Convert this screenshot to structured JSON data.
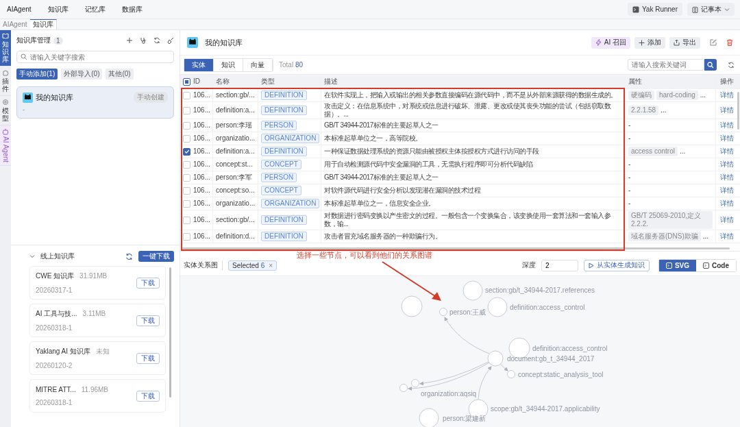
{
  "topnav": [
    "AIAgent",
    "知识库",
    "记忆库",
    "数据库"
  ],
  "top_actions": [
    {
      "label": "Yak Runner",
      "kind": "runner"
    },
    {
      "label": "记事本",
      "kind": "notes"
    }
  ],
  "page_tabs": [
    {
      "label": "AIAgent",
      "selected": false
    },
    {
      "label": "知识库",
      "selected": true
    }
  ],
  "rail": [
    {
      "label": "知识库",
      "kind": "book",
      "selected": true
    },
    {
      "label": "插件",
      "kind": "plugin",
      "selected": false
    },
    {
      "label": "模型",
      "kind": "model",
      "selected": false
    },
    {
      "label": "AI Agent",
      "kind": "agent",
      "selected": false
    }
  ],
  "kb_panel": {
    "title": "知识库管理",
    "count": "1",
    "search": {
      "placeholder": "请输入关键字搜索"
    },
    "filters": [
      {
        "label": "手动添加(1)",
        "selected": true
      },
      {
        "label": "外部导入(0)",
        "selected": false
      },
      {
        "label": "其他(0)",
        "selected": false
      }
    ],
    "cards": [
      {
        "name": "我的知识库",
        "tag": "手动创建",
        "description": "-",
        "selected": true
      }
    ]
  },
  "online": {
    "title": "线上知识库",
    "expanded": true,
    "download_all": "一键下载",
    "items": [
      {
        "name": "CWE 知识库",
        "size": "31.91MB",
        "version": "20260317-1",
        "action": "下载"
      },
      {
        "name": "AI 工具与技...",
        "size": "3.11MB",
        "version": "20260318-1",
        "action": "下载"
      },
      {
        "name": "Yaklang AI 知识库",
        "size": "未知",
        "version": "20260120-2",
        "action": "下载"
      },
      {
        "name": "MITRE ATT...",
        "size": "11.96MB",
        "version": "20260318-1",
        "action": "下载"
      }
    ]
  },
  "kb": {
    "title": "我的知识库",
    "actions": [
      {
        "label": "AI 召回",
        "kind": "ai"
      },
      {
        "label": "添加",
        "kind": "add"
      },
      {
        "label": "导出",
        "kind": "export"
      }
    ],
    "views": [
      {
        "label": "实体",
        "selected": true
      },
      {
        "label": "知识",
        "selected": false
      },
      {
        "label": "向量",
        "selected": false
      }
    ],
    "total_label": "Total",
    "total": "80",
    "search": {
      "placeholder": "请输入搜索关键词"
    }
  },
  "table": {
    "select_all_indeterminate": true,
    "columns": [
      "ID",
      "名称",
      "类型",
      "描述",
      "属性",
      "操作"
    ],
    "rows": [
      {
        "checked": false,
        "id": "106...",
        "name": "section:gb/...",
        "type": "DEFINITION",
        "description": "在软件实现上，把输入或输出的相关参数直接编码在源代码中，而不是从外部来源获得的数据生成的。",
        "attributes": {
          "tags": [
            "硬编码",
            "hard-coding"
          ],
          "more": "..."
        },
        "action": "详情"
      },
      {
        "checked": false,
        "id": "106...",
        "name": "definition:a...",
        "type": "DEFINITION",
        "description": "攻击定义：在信息系统中，对系统或信息进行破坏、泄露、更改或使其丧失功能的尝试（包括窃取数据）。...",
        "attributes": {
          "tags": [
            "2.2.1.58"
          ],
          "more": "..."
        },
        "action": "详情"
      },
      {
        "checked": false,
        "id": "106...",
        "name": "person:李瑶",
        "type": "PERSON",
        "description": "GB/T 34944-2017标准的主要起草人之一",
        "attributes": {
          "text": "-"
        },
        "action": "详情"
      },
      {
        "checked": false,
        "id": "106...",
        "name": "organizatio...",
        "type": "ORGANIZATION",
        "description": "本标准起草单位之一，高等院校。",
        "attributes": {
          "text": "-"
        },
        "action": "详情"
      },
      {
        "checked": true,
        "id": "106...",
        "name": "definition:a...",
        "type": "DEFINITION",
        "description": "一种保证数据处理系统的资源只能由被授权主体按授权方式进行访问的手段",
        "attributes": {
          "tags": [
            "access control"
          ],
          "more": "..."
        },
        "action": "详情"
      },
      {
        "checked": false,
        "id": "106...",
        "name": "concept:st...",
        "type": "CONCEPT",
        "description": "用于自动检测源代码中安全漏洞的工具，无需执行程序即可分析代码缺陷",
        "attributes": {
          "text": "-"
        },
        "action": "详情"
      },
      {
        "checked": false,
        "id": "106...",
        "name": "person:李军",
        "type": "PERSON",
        "description": "GB/T 34944-2017标准的主要起草人之一",
        "attributes": {
          "text": "-"
        },
        "action": "详情"
      },
      {
        "checked": false,
        "id": "106...",
        "name": "concept:so...",
        "type": "CONCEPT",
        "description": "对软件源代码进行安全分析以发现潜在漏洞的技术过程",
        "attributes": {
          "text": "-"
        },
        "action": "详情"
      },
      {
        "checked": false,
        "id": "106...",
        "name": "organizatio...",
        "type": "ORGANIZATION",
        "description": "本标准起草单位之一，信息安全企业。",
        "attributes": {
          "text": "-"
        },
        "action": "详情"
      },
      {
        "checked": false,
        "id": "106...",
        "name": "section:gb/...",
        "type": "DEFINITION",
        "description": "对数据进行密码变换以产生密文的过程。一般包含一个变换集合，该变换使用一套算法和一套输入参数，输...",
        "attributes": {
          "tags": [
            "GB/T 25069-2010,定义2.2.2."
          ]
        },
        "action": "详情"
      },
      {
        "checked": false,
        "id": "106...",
        "name": "definition:d...",
        "type": "DEFINITION",
        "description": "攻击者冒充域名服务器的一种欺骗行为。",
        "attributes": {
          "tags": [
            "域名服务器(DNS)欺骗"
          ],
          "more": "..."
        },
        "action": "详情"
      }
    ]
  },
  "graph": {
    "title": "实体关系图",
    "selected_label": "Selected",
    "selected_count": "6",
    "remove": "×",
    "depth_label": "深度",
    "depth": "2",
    "generate": "从实体生成知识",
    "modes": [
      {
        "label": "SVG",
        "selected": true
      },
      {
        "label": "Code",
        "selected": false
      }
    ],
    "nodes": [
      {
        "label": "person:王威"
      },
      {
        "label": "section:gb/t_34944-2017.references"
      },
      {
        "label": "definition:access_control"
      },
      {
        "label": "definition:access_control"
      },
      {
        "label": "document:gb_t_34944_2017"
      },
      {
        "label": "concept:static_analysis_tool"
      },
      {
        "label": "organization:aqsiq"
      },
      {
        "label": "scope:gb/t_34944-2017.applicability"
      },
      {
        "label": "person:梁建新"
      }
    ]
  },
  "annotation": {
    "text": "选择一些节点，可以看到他们的关系图谱"
  }
}
